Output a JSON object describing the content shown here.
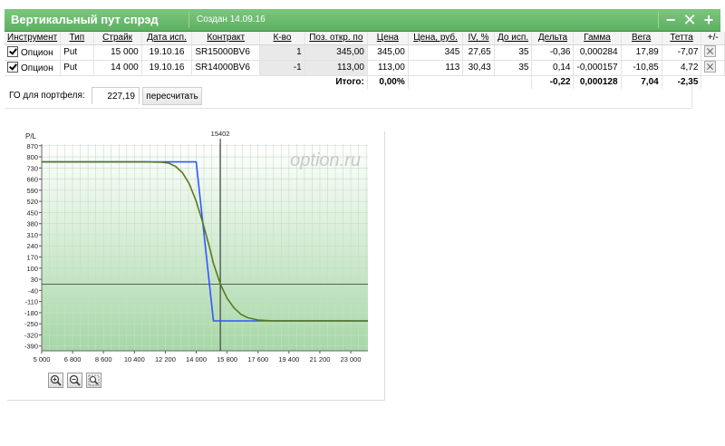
{
  "window": {
    "title": "Вертикальный пут спрэд",
    "created": "Создан 14.09.16",
    "controls": [
      {
        "name": "minimize-button",
        "glyph": "−"
      },
      {
        "name": "close-button",
        "glyph": "✕"
      },
      {
        "name": "add-button",
        "glyph": "+"
      }
    ]
  },
  "table": {
    "headers": [
      "Инструмент",
      "Тип",
      "Страйк",
      "Дата исп.",
      "Контракт",
      "К-во",
      "Поз. откр. по",
      "Цена",
      "Цена, руб.",
      "IV, %",
      "До исп.",
      "Дельта",
      "Гамма",
      "Вега",
      "Тетта",
      "+/-"
    ],
    "rows": [
      {
        "checked": true,
        "instrument": "Опцион",
        "type": "Put",
        "strike": "15 000",
        "date": "19.10.16",
        "contract": "SR15000BV6",
        "qty": "1",
        "open": "345,00",
        "price": "345,00",
        "price_rub": "345",
        "iv": "27,65",
        "days": "35",
        "delta": "-0,36",
        "gamma": "0,000284",
        "vega": "17,89",
        "theta": "-7,07"
      },
      {
        "checked": true,
        "instrument": "Опцион",
        "type": "Put",
        "strike": "14 000",
        "date": "19.10.16",
        "contract": "SR14000BV6",
        "qty": "-1",
        "open": "113,00",
        "price": "113,00",
        "price_rub": "113",
        "iv": "30,43",
        "days": "35",
        "delta": "0,14",
        "gamma": "-0,000157",
        "vega": "-10,85",
        "theta": "4,72"
      }
    ],
    "totals": {
      "label": "Итого:",
      "price": "0,00%",
      "delta": "-0,22",
      "gamma": "0,000128",
      "vega": "7,04",
      "theta": "-2,35"
    }
  },
  "go": {
    "label": "ГО для портфеля:",
    "value": "227,19",
    "button": "пересчитать"
  },
  "colors": {
    "header_green": "#5eb062",
    "grid_line": "#c4dfc4",
    "expiry_line": "#3355ff",
    "current_line": "#5a7a1e",
    "fill_top": "#ffffff",
    "fill_bottom": "#a6d7a6"
  },
  "zoom_buttons": [
    {
      "name": "zoom-in-button",
      "icon": "zoom-in-icon"
    },
    {
      "name": "zoom-out-button",
      "icon": "zoom-out-icon"
    },
    {
      "name": "zoom-reset-button",
      "icon": "zoom-fit-icon"
    }
  ],
  "chart_data": {
    "type": "line",
    "ylabel": "P/L",
    "watermark": "option.ru",
    "xlim": [
      5000,
      24000
    ],
    "ylim": [
      -420,
      880
    ],
    "x_ticks": [
      5000,
      6800,
      8600,
      10400,
      12200,
      14000,
      15800,
      17600,
      19400,
      21200,
      23000
    ],
    "x_tick_labels": [
      "5 000",
      "6 800",
      "8 600",
      "10 400",
      "12 200",
      "14 000",
      "15 800",
      "17 600",
      "19 400",
      "21 200",
      "23 000"
    ],
    "y_ticks": [
      870,
      800,
      730,
      660,
      590,
      520,
      450,
      380,
      310,
      240,
      170,
      100,
      30,
      -40,
      -110,
      -180,
      -250,
      -320,
      -390
    ],
    "current_price": 15402,
    "current_price_label": "15402",
    "series": [
      {
        "points": [
          [
            5000,
            768
          ],
          [
            14000,
            768
          ],
          [
            15000,
            -232
          ],
          [
            24000,
            -232
          ]
        ]
      },
      {
        "points": [
          [
            5000,
            768
          ],
          [
            11000,
            768
          ],
          [
            12000,
            766
          ],
          [
            12400,
            760
          ],
          [
            12800,
            740
          ],
          [
            13200,
            700
          ],
          [
            13600,
            630
          ],
          [
            14000,
            520
          ],
          [
            14400,
            380
          ],
          [
            14800,
            220
          ],
          [
            15000,
            130
          ],
          [
            15400,
            0
          ],
          [
            15800,
            -90
          ],
          [
            16200,
            -150
          ],
          [
            16600,
            -190
          ],
          [
            17000,
            -212
          ],
          [
            17600,
            -226
          ],
          [
            18400,
            -231
          ],
          [
            24000,
            -232
          ]
        ]
      }
    ]
  }
}
